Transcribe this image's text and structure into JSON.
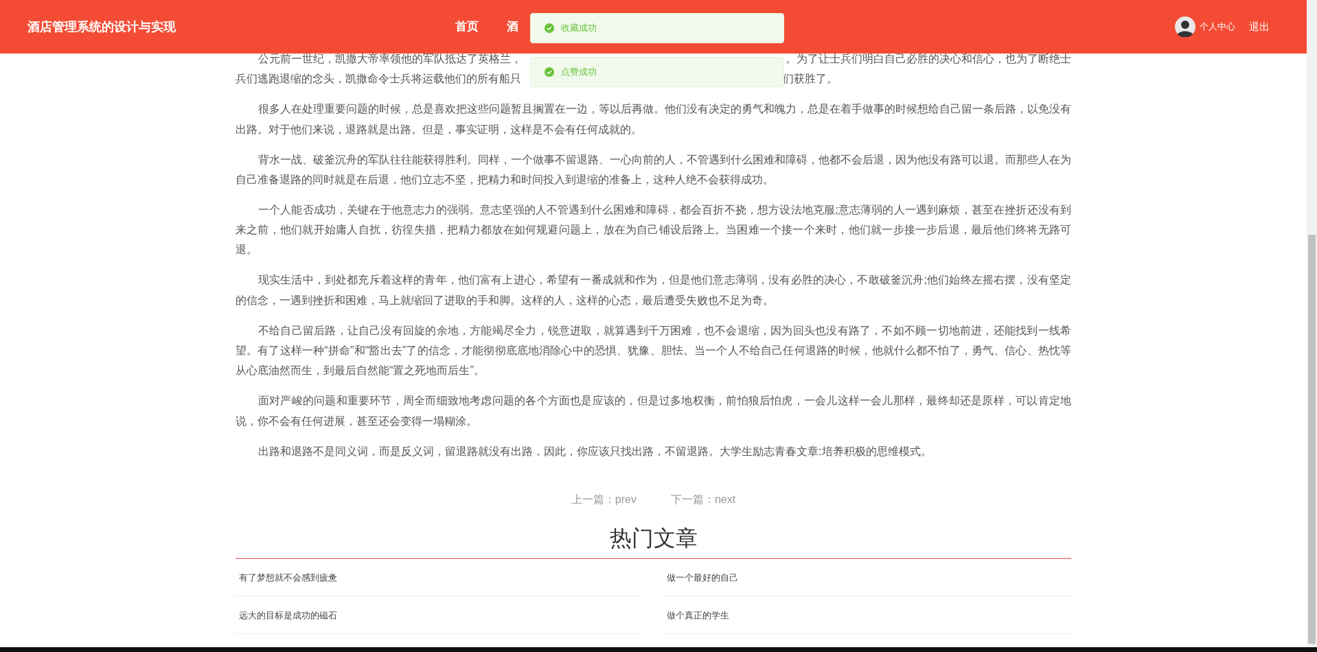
{
  "header": {
    "title": "酒店管理系统的设计与实现",
    "nav": [
      {
        "label": "首页"
      },
      {
        "label": "酒"
      }
    ],
    "user_link": "个人中心",
    "logout": "退出"
  },
  "toasts": [
    {
      "message": "收藏成功"
    },
    {
      "message": "点赞成功"
    }
  ],
  "article": {
    "first_paragraph_fragments": {
      "line_1_left": "公元前一世纪，凯撒大帝率领他的军队抵达了英格兰，",
      "line_1_right": "。为了让士兵们明白自己必胜的决心和信心，也为了断绝士",
      "line_2_left": "兵们逃跑退缩的念头，凯撒命令士兵将运载他们的所有船只",
      "line_2_right": "们获胜了。"
    },
    "paragraphs": [
      "很多人在处理重要问题的时候，总是喜欢把这些问题暂且搁置在一边，等以后再做。他们没有决定的勇气和魄力，总是在着手做事的时候想给自己留一条后路，以免没有出路。对于他们来说，退路就是出路。但是，事实证明，这样是不会有任何成就的。",
      "背水一战、破釜沉舟的军队往往能获得胜利。同样，一个做事不留退路、一心向前的人，不管遇到什么困难和障碍，他都不会后退，因为他没有路可以退。而那些人在为自己准备退路的同时就是在后退，他们立志不坚，把精力和时间投入到退缩的准备上，这种人绝不会获得成功。",
      "一个人能否成功，关键在于他意志力的强弱。意志坚强的人不管遇到什么困难和障碍，都会百折不挠，想方设法地克服;意志薄弱的人一遇到麻烦，甚至在挫折还没有到来之前，他们就开始庸人自扰，彷徨失措，把精力都放在如何规避问题上，放在为自己铺设后路上。当困难一个接一个来时，他们就一步接一步后退，最后他们终将无路可退。",
      "现实生活中，到处都充斥着这样的青年，他们富有上进心，希望有一番成就和作为，但是他们意志薄弱，没有必胜的决心，不敢破釜沉舟;他们始终左摇右摆，没有坚定的信念，一遇到挫折和困难，马上就缩回了进取的手和脚。这样的人，这样的心态，最后遭受失败也不足为奇。",
      "不给自己留后路，让自己没有回旋的余地，方能竭尽全力，锐意进取，就算遇到千万困难，也不会退缩，因为回头也没有路了，不如不顾一切地前进，还能找到一线希望。有了这样一种“拼命”和“豁出去”了的信念，才能彻彻底底地消除心中的恐惧、犹豫、胆怯。当一个人不给自己任何退路的时候，他就什么都不怕了，勇气、信心、热忱等从心底油然而生，到最后自然能“置之死地而后生”。",
      "面对严峻的问题和重要环节，周全而细致地考虑问题的各个方面也是应该的，但是过多地权衡，前怕狼后怕虎，一会儿这样一会儿那样，最终却还是原样，可以肯定地说，你不会有任何进展，甚至还会变得一塌糊涂。",
      "出路和退路不是同义词，而是反义词，留退路就没有出路，因此，你应该只找出路，不留退路。大学生励志青春文章:培养积极的思维模式。"
    ],
    "prev": "上一篇：prev",
    "next": "下一篇：next"
  },
  "hot_articles": {
    "title": "热门文章",
    "items": [
      "有了梦想就不会感到疲惫",
      "做一个最好的自己",
      "远大的目标是成功的磁石",
      "做个真正的学生"
    ]
  }
}
